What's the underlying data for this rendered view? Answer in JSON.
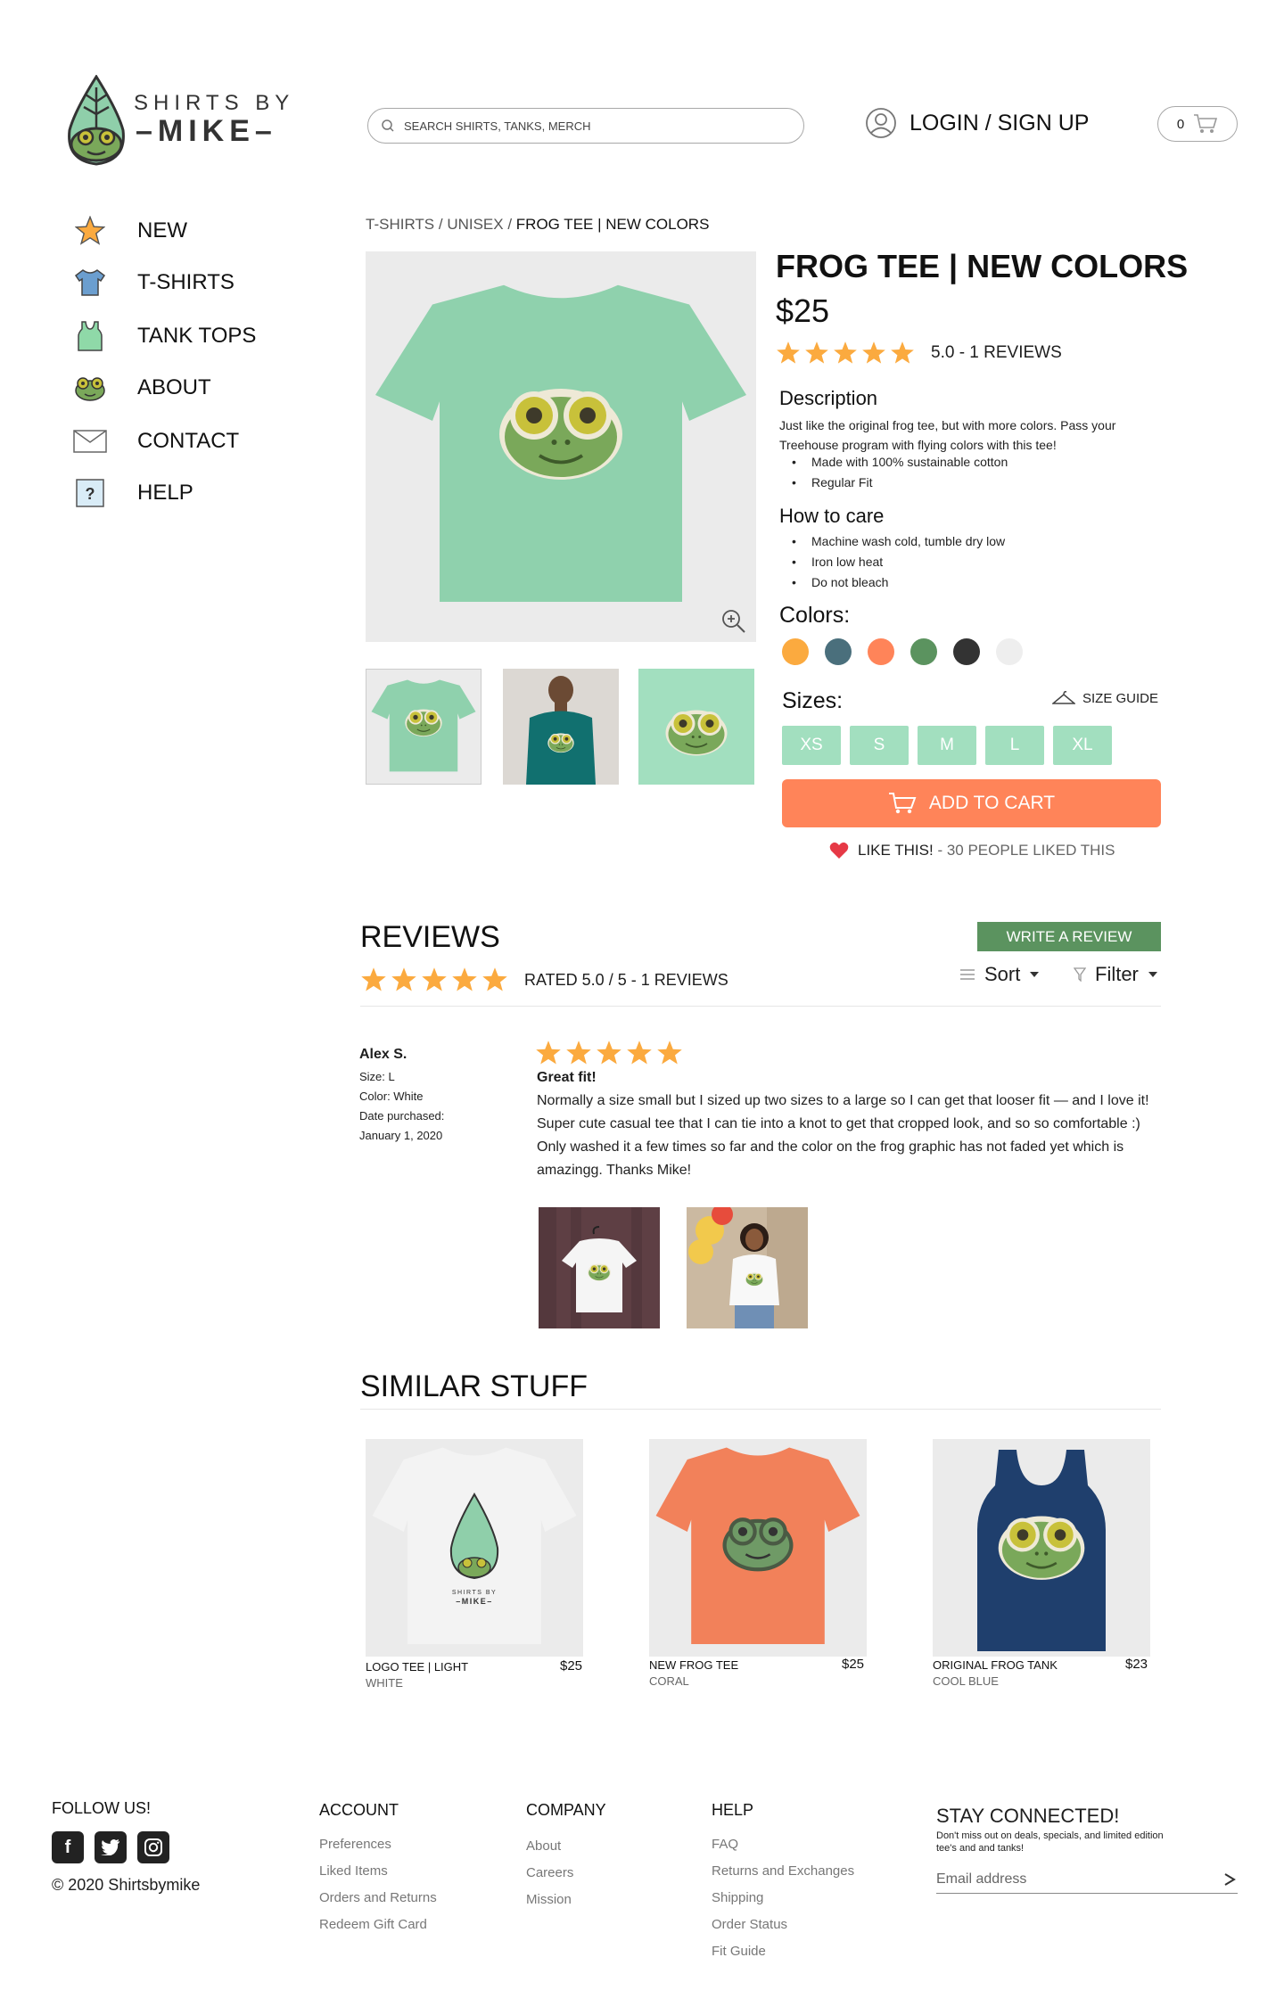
{
  "brand": {
    "line1": "SHIRTS BY",
    "line2": "–MIKE–"
  },
  "search": {
    "placeholder": "SEARCH SHIRTS, TANKS, MERCH"
  },
  "account": {
    "login_label": "LOGIN / SIGN UP"
  },
  "cart": {
    "count": "0"
  },
  "sidebar": {
    "items": [
      {
        "label": "NEW",
        "icon": "star-icon"
      },
      {
        "label": "T-SHIRTS",
        "icon": "tshirt-icon"
      },
      {
        "label": "TANK TOPS",
        "icon": "tank-top-icon"
      },
      {
        "label": "ABOUT",
        "icon": "frog-icon"
      },
      {
        "label": "CONTACT",
        "icon": "envelope-icon"
      },
      {
        "label": "HELP",
        "icon": "help-icon"
      }
    ]
  },
  "breadcrumb": {
    "c1": "T-SHIRTS",
    "sep": " / ",
    "c2": "UNISEX",
    "c3": "FROG TEE",
    "c4": "NEW COLORS"
  },
  "product": {
    "title": "FROG TEE | NEW COLORS",
    "price": "$25",
    "rating_text": "5.0 - 1 REVIEWS",
    "rating": 5,
    "description_heading": "Description",
    "description": "Just like the original frog tee, but with more colors. Pass your Treehouse program with flying colors with this tee!",
    "description_bullets": [
      "Made with 100% sustainable cotton",
      "Regular Fit"
    ],
    "care_heading": "How to care",
    "care_bullets": [
      "Machine wash cold, tumble dry low",
      "Iron low heat",
      "Do not bleach"
    ],
    "colors_heading": "Colors:",
    "colors": [
      "#fbaa3f",
      "#4a6f7c",
      "#ff8459",
      "#5b935f",
      "#333333",
      "#eeeeee"
    ],
    "sizes_heading": "Sizes:",
    "size_guide": "SIZE GUIDE",
    "sizes": [
      "XS",
      "S",
      "M",
      "L",
      "XL"
    ],
    "add_to_cart": "ADD TO CART",
    "like_label": "LIKE THIS!",
    "like_sep": " - ",
    "like_count": "30 PEOPLE LIKED THIS"
  },
  "reviews": {
    "title": "REVIEWS",
    "write_button": "WRITE A REVIEW",
    "summary": "RATED 5.0 / 5 - 1 REVIEWS",
    "sort_label": "Sort",
    "filter_label": "Filter",
    "items": [
      {
        "name": "Alex S.",
        "size": "Size: L",
        "color": "Color: White",
        "date_label": "Date purchased:",
        "date": "January 1, 2020",
        "stars": 5,
        "headline": "Great fit!",
        "body": "Normally a size small but I sized up two sizes to a large so I can get that looser fit — and I love it! Super cute casual tee that I can tie into a knot to get that cropped look, and so so comfortable :) Only washed it a few times so far and the color on the frog graphic has not faded yet which is amazingg. Thanks Mike!"
      }
    ]
  },
  "similar": {
    "title": "SIMILAR STUFF",
    "items": [
      {
        "name": "LOGO TEE | LIGHT",
        "color": "WHITE",
        "price": "$25"
      },
      {
        "name": "NEW FROG TEE",
        "color": "CORAL",
        "price": "$25"
      },
      {
        "name": "ORIGINAL FROG TANK",
        "color": "COOL BLUE",
        "price": "$23"
      }
    ]
  },
  "footer": {
    "follow": "FOLLOW US!",
    "copyright": "© 2020 Shirtsbymike",
    "account": {
      "heading": "ACCOUNT",
      "links": [
        "Preferences",
        "Liked Items",
        "Orders and Returns",
        "Redeem Gift Card"
      ]
    },
    "company": {
      "heading": "COMPANY",
      "links": [
        "About",
        "Careers",
        "Mission"
      ]
    },
    "help": {
      "heading": "HELP",
      "links": [
        "FAQ",
        "Returns and Exchanges",
        "Shipping",
        "Order Status",
        "Fit Guide"
      ]
    },
    "newsletter": {
      "heading": "STAY CONNECTED!",
      "subtext": "Don't miss out on deals, specials, and limited edition tee's and and tanks!",
      "placeholder": "Email address"
    }
  },
  "colors": {
    "mint": "#a2dfbf",
    "coral": "#ff8459",
    "green": "#5b935f",
    "star": "#fbaa3f"
  }
}
